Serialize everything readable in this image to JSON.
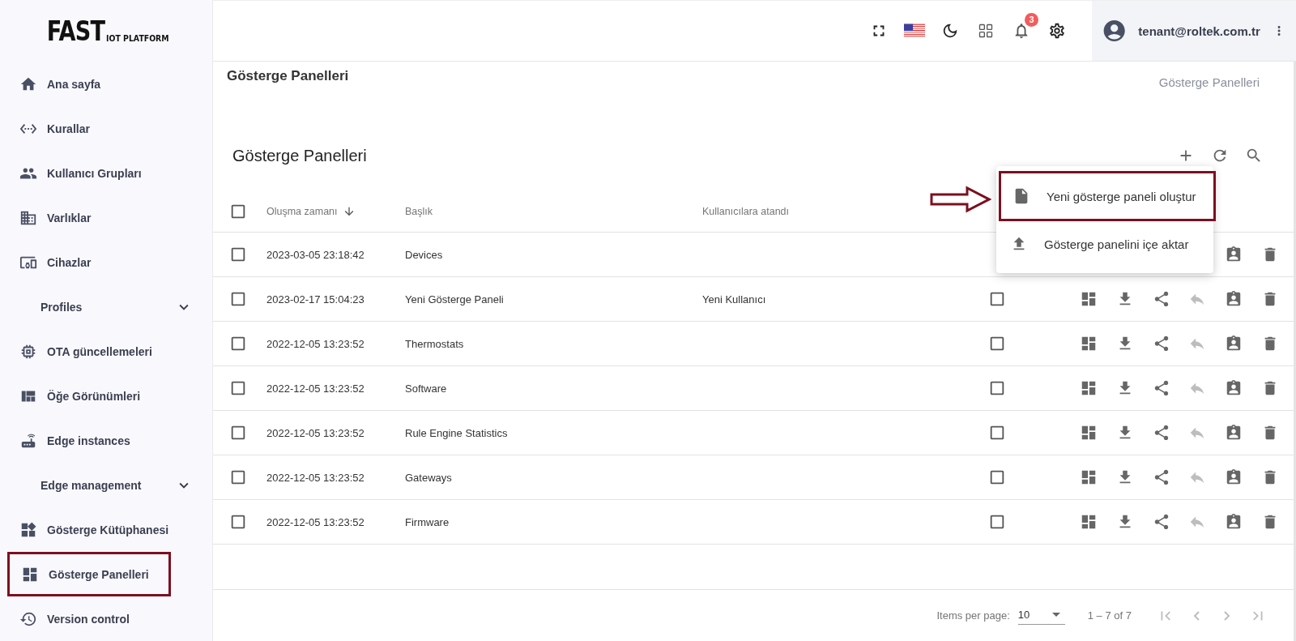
{
  "logo": {
    "main": "FAST",
    "sub": "IOT PLATFORM"
  },
  "sidebar": {
    "items": [
      {
        "kind": "link",
        "label": "Ana sayfa",
        "selected": false
      },
      {
        "kind": "link",
        "label": "Kurallar",
        "selected": false
      },
      {
        "kind": "link",
        "label": "Kullanıcı Grupları",
        "selected": false
      },
      {
        "kind": "link",
        "label": "Varlıklar",
        "selected": false
      },
      {
        "kind": "link",
        "label": "Cihazlar",
        "selected": false
      },
      {
        "kind": "section",
        "label": "Profiles",
        "expanded": false
      },
      {
        "kind": "link",
        "label": "OTA güncellemeleri",
        "selected": false
      },
      {
        "kind": "link",
        "label": "Öğe Görünümleri",
        "selected": false
      },
      {
        "kind": "link",
        "label": "Edge instances",
        "selected": false
      },
      {
        "kind": "section",
        "label": "Edge management",
        "expanded": false
      },
      {
        "kind": "link",
        "label": "Gösterge Kütüphanesi",
        "selected": false
      },
      {
        "kind": "link",
        "label": "Gösterge Panelleri",
        "selected": true
      },
      {
        "kind": "link",
        "label": "Version control",
        "selected": false
      }
    ]
  },
  "topbar": {
    "notification_count": "3",
    "user": "tenant@roltek.com.tr"
  },
  "page": {
    "title": "Gösterge Panelleri",
    "breadcrumb": "Gösterge Panelleri"
  },
  "card": {
    "title": "Gösterge Panelleri",
    "all_selected": false,
    "columns": [
      {
        "label": "Oluşma zamanı",
        "sorted": true
      },
      {
        "label": "Başlık",
        "sorted": false
      },
      {
        "label": "Kullanıcılara atandı",
        "sorted": false
      }
    ],
    "rows": [
      {
        "created": "2023-03-05 23:18:42",
        "title": "Devices",
        "selected": false
      },
      {
        "created": "2023-02-17 15:04:23",
        "title": "Yeni Gösterge Paneli",
        "assigned": "Yeni Kullanıcı",
        "public": false,
        "selected": false
      },
      {
        "created": "2022-12-05 13:23:52",
        "title": "Thermostats",
        "public": false,
        "selected": false
      },
      {
        "created": "2022-12-05 13:23:52",
        "title": "Software",
        "public": false,
        "selected": false
      },
      {
        "created": "2022-12-05 13:23:52",
        "title": "Rule Engine Statistics",
        "public": false,
        "selected": false
      },
      {
        "created": "2022-12-05 13:23:52",
        "title": "Gateways",
        "public": false,
        "selected": false
      },
      {
        "created": "2022-12-05 13:23:52",
        "title": "Firmware",
        "public": false,
        "selected": false
      }
    ],
    "menu": {
      "open": true,
      "items": [
        {
          "label": "Yeni gösterge paneli oluştur",
          "highlighted": true
        },
        {
          "label": "Gösterge panelini içe aktar",
          "highlighted": false
        }
      ]
    },
    "pagination": {
      "label": "Items per page:",
      "page_size": "10",
      "range": "1 – 7 of 7",
      "first_disabled": true,
      "prev_disabled": true,
      "next_disabled": true,
      "last_disabled": true
    }
  }
}
